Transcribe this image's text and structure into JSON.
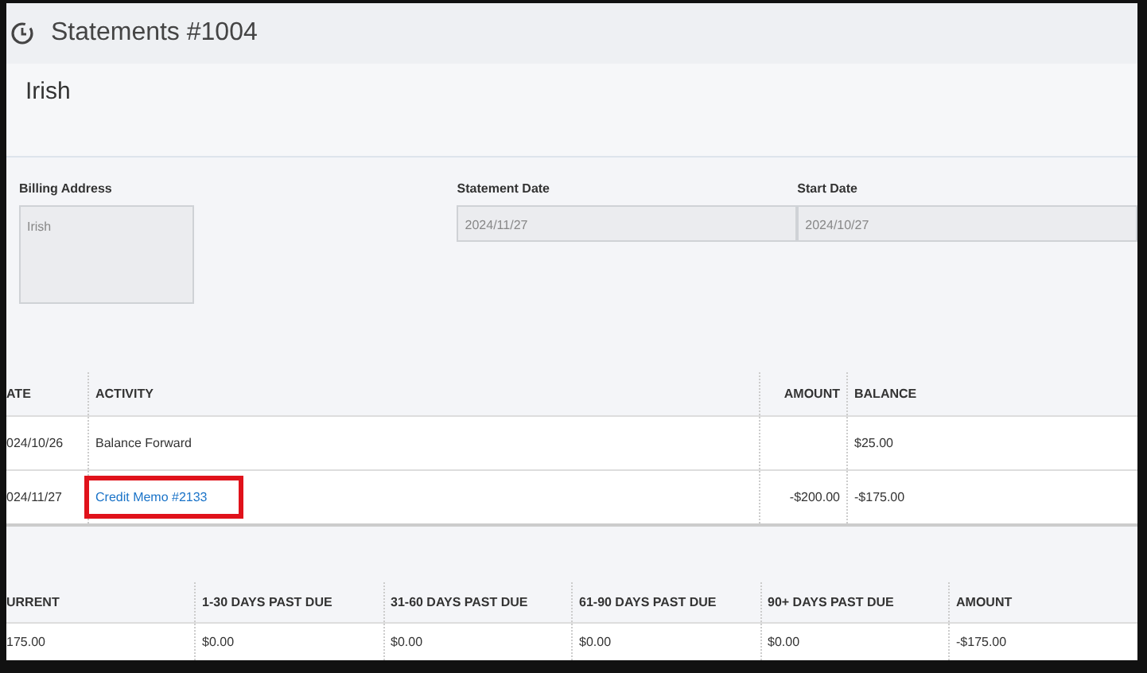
{
  "window": {
    "title": "Statements #1004"
  },
  "customer": {
    "name": "Irish"
  },
  "fields": [
    {
      "label": "Billing Address",
      "value": "Irish",
      "kind": "area"
    },
    {
      "label": "Statement Date",
      "value": "2024/11/27",
      "kind": "line"
    },
    {
      "label": "Start Date",
      "value": "2024/10/27",
      "kind": "line"
    }
  ],
  "activity_table": {
    "columns": [
      "ATE",
      "ACTIVITY",
      "AMOUNT",
      "BALANCE"
    ],
    "rows": [
      {
        "date": "024/10/26",
        "activity": "Balance Forward",
        "link": false,
        "highlighted": false,
        "amount": "",
        "balance": "$25.00"
      },
      {
        "date": "024/11/27",
        "activity": "Credit Memo #2133",
        "link": true,
        "highlighted": true,
        "amount": "-$200.00",
        "balance": "-$175.00"
      }
    ]
  },
  "aging_table": {
    "columns": [
      "URRENT",
      "1-30 DAYS PAST DUE",
      "31-60 DAYS PAST DUE",
      "61-90 DAYS PAST DUE",
      "90+ DAYS PAST DUE",
      "AMOUNT"
    ],
    "rows": [
      [
        "175.00",
        "$0.00",
        "$0.00",
        "$0.00",
        "$0.00",
        "-$175.00"
      ]
    ]
  }
}
